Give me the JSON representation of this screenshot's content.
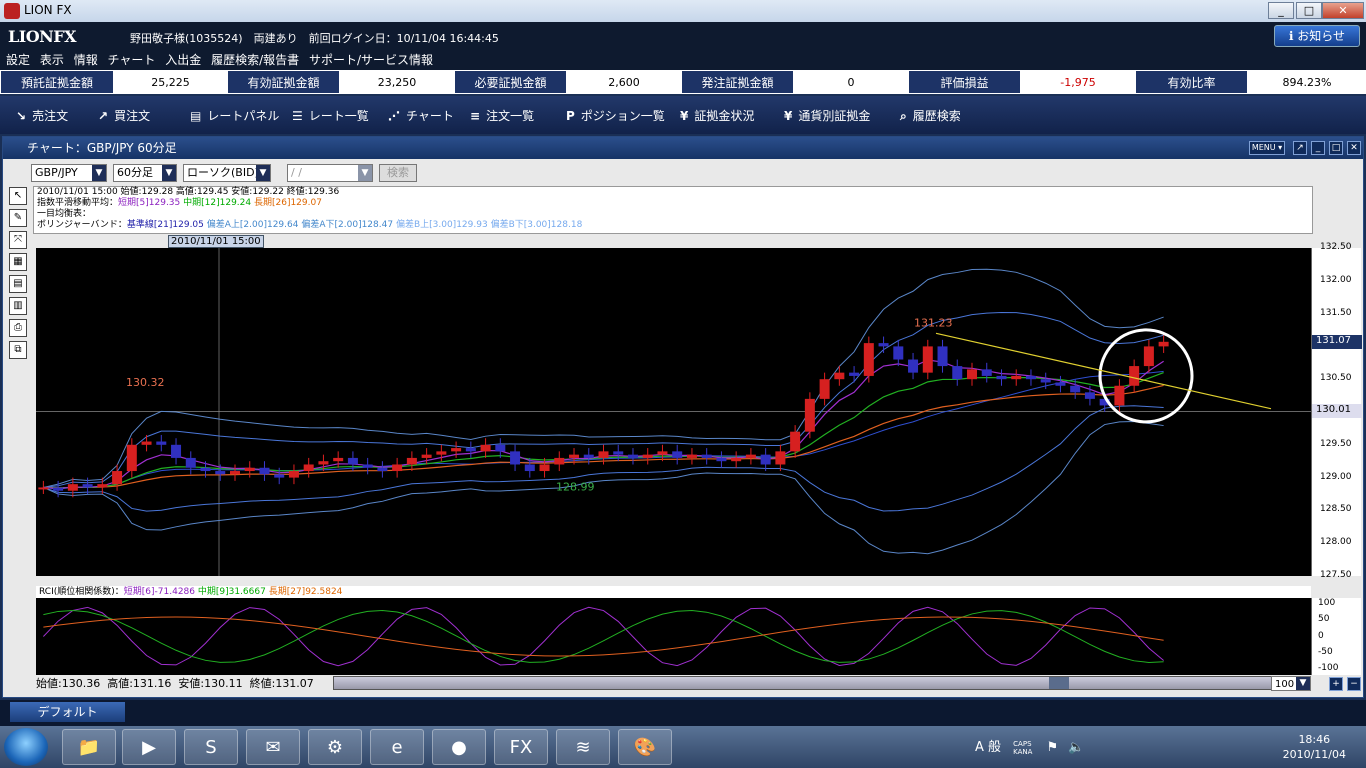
{
  "window": {
    "title": "LION FX",
    "min": "_",
    "max": "□",
    "close": "✕"
  },
  "header": {
    "logo": "LIONFX",
    "user": "野田敬子様(1035524)　両建あり　前回ログイン日：10/11/04  16:44:45",
    "notice": "お知らせ"
  },
  "menu": [
    "設定",
    "表示",
    "情報",
    "チャート",
    "入出金",
    "履歴検索/報告書",
    "サポート/サービス情報"
  ],
  "balances": [
    {
      "label": "預託証拠金額",
      "value": "25,225"
    },
    {
      "label": "有効証拠金額",
      "value": "23,250"
    },
    {
      "label": "必要証拠金額",
      "value": "2,600"
    },
    {
      "label": "発注証拠金額",
      "value": "0"
    },
    {
      "label": "評価損益",
      "value": "-1,975"
    },
    {
      "label": "有効比率",
      "value": "894.23%"
    }
  ],
  "toolbar": [
    {
      "icon": "↘",
      "label": "売注文"
    },
    {
      "icon": "↗",
      "label": "買注文"
    },
    {
      "icon": "▤",
      "label": "レートパネル"
    },
    {
      "icon": "☰",
      "label": "レート一覧"
    },
    {
      "icon": "⋰",
      "label": "チャート"
    },
    {
      "icon": "≡",
      "label": "注文一覧"
    },
    {
      "icon": "P",
      "label": "ポジション一覧"
    },
    {
      "icon": "¥",
      "label": "証拠金状況"
    },
    {
      "icon": "¥",
      "label": "通貨別証拠金"
    },
    {
      "icon": "⌕",
      "label": "履歴検索"
    }
  ],
  "chart_window": {
    "title": "チャート：GBP/JPY 60分足",
    "menu": "MENU ▾",
    "pair": "GBP/JPY",
    "timeframe": "60分足",
    "type": "ローソク(BID)",
    "date": "/ /",
    "search": "検索"
  },
  "info": {
    "line1": "2010/11/01 15:00  始値:129.28  高値:129.45  安値:129.22  終値:129.36",
    "line2_label": "指数平滑移動平均：",
    "short": "短期[5]129.35",
    "mid": "中期[12]129.24",
    "long": "長期[26]129.07",
    "line3": "一目均衡表：",
    "line4_label": "ボリンジャーバンド：",
    "bb_mid": "基準線[21]129.05",
    "bb_up2": "偏差A上[2.00]129.64",
    "bb_dn2": "偏差A下[2.00]128.47",
    "bb_up3": "偏差B上[3.00]129.93",
    "bb_dn3": "偏差B下[3.00]128.18",
    "cursor_time": "2010/11/01 15:00"
  },
  "chart_data": {
    "type": "line",
    "ylim": [
      127.5,
      132.5
    ],
    "yticks": [
      "132.50",
      "132.00",
      "131.50",
      "131.00",
      "130.50",
      "130.00",
      "129.50",
      "129.00",
      "128.50",
      "128.00",
      "127.50"
    ],
    "labels": {
      "high1": "130.32",
      "low1": "128.99",
      "high2": "131.23"
    },
    "price_tag": "131.07",
    "line_tag": "130.01",
    "close": [
      128.85,
      128.8,
      128.9,
      128.85,
      128.9,
      129.1,
      129.5,
      129.55,
      129.5,
      129.3,
      129.15,
      129.1,
      129.05,
      129.1,
      129.15,
      129.05,
      129.0,
      129.1,
      129.2,
      129.25,
      129.3,
      129.2,
      129.15,
      129.1,
      129.2,
      129.3,
      129.35,
      129.4,
      129.45,
      129.4,
      129.5,
      129.4,
      129.2,
      129.1,
      129.2,
      129.3,
      129.35,
      129.3,
      129.4,
      129.35,
      129.3,
      129.35,
      129.4,
      129.3,
      129.35,
      129.3,
      129.25,
      129.3,
      129.35,
      129.2,
      129.4,
      129.7,
      130.2,
      130.5,
      130.6,
      130.55,
      131.05,
      131.0,
      130.8,
      130.6,
      131.0,
      130.7,
      130.5,
      130.65,
      130.55,
      130.5,
      130.55,
      130.5,
      130.45,
      130.4,
      130.3,
      130.2,
      130.1,
      130.4,
      130.7,
      131.0,
      131.07
    ],
    "rci": {
      "label_title": "RCI(順位相関係数)：",
      "short": "短期[6]-71.4286",
      "mid": "中期[9]31.6667",
      "long": "長期[27]92.5824",
      "ticks": [
        "100",
        "50",
        "0",
        "-50",
        "-100"
      ]
    }
  },
  "ohlc_bar": {
    "open": "始値:130.36",
    "high": "高値:131.16",
    "low": "安値:130.11",
    "close": "終値:131.07"
  },
  "zoom": "100",
  "tabs": {
    "default": "デフォルト"
  },
  "taskbar": {
    "time": "18:46",
    "date": "2010/11/04",
    "ime": "A 般",
    "caps": "CAPS",
    "kana": "KANA"
  }
}
